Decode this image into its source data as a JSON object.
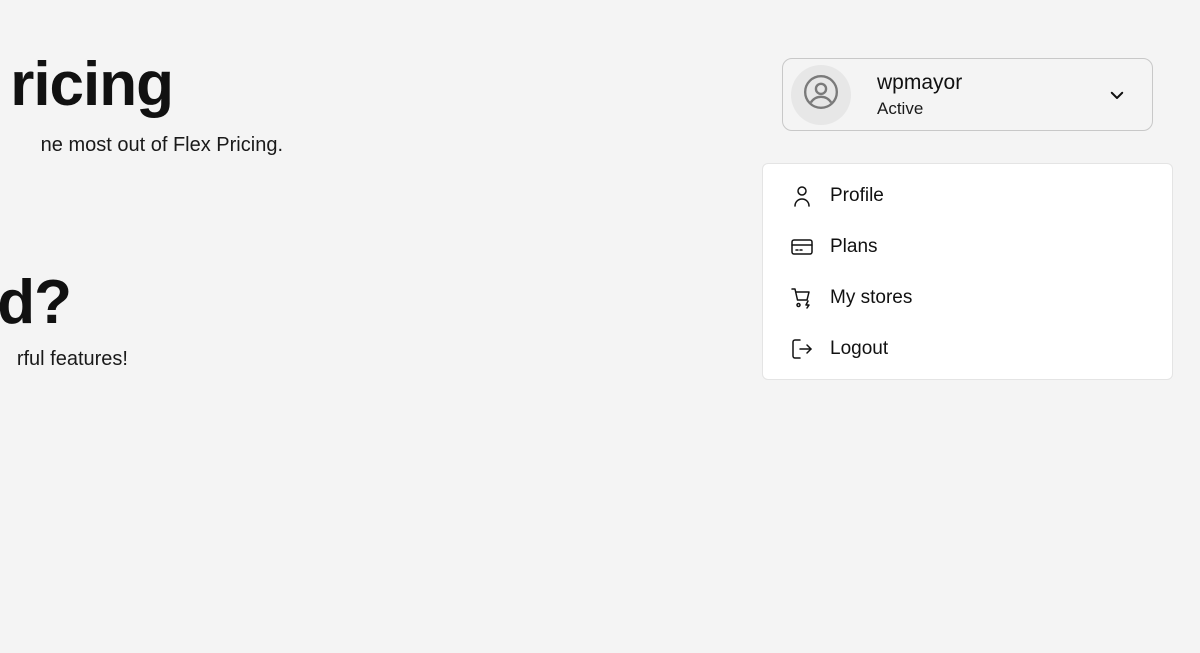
{
  "main": {
    "hero_title": "ricing",
    "hero_subtitle": "ne most out of Flex Pricing.",
    "section_title": "d?",
    "section_subtitle": "rful features!"
  },
  "account": {
    "username": "wpmayor",
    "status": "Active",
    "avatar_icon": "user-circle-icon",
    "toggle_icon": "chevron-down-icon"
  },
  "menu": {
    "items": [
      {
        "label": "Profile",
        "icon": "user-icon"
      },
      {
        "label": "Plans",
        "icon": "credit-card-icon"
      },
      {
        "label": "My stores",
        "icon": "cart-icon"
      },
      {
        "label": "Logout",
        "icon": "logout-icon"
      }
    ]
  }
}
